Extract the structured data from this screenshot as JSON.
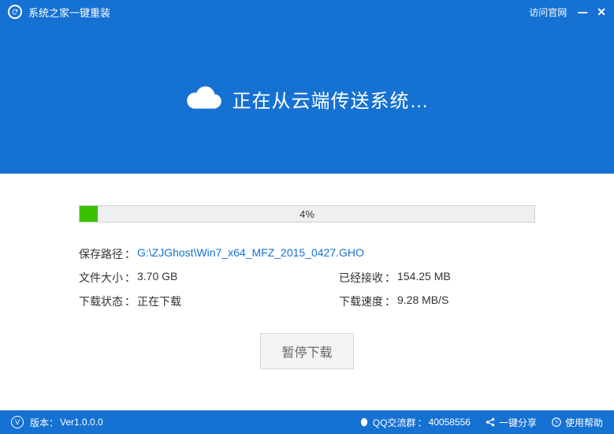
{
  "titlebar": {
    "title": "系统之家一键重装",
    "officialLink": "访问官网"
  },
  "hero": {
    "text": "正在从云端传送系统…"
  },
  "progress": {
    "percent": 4,
    "text": "4%"
  },
  "info": {
    "pathLabel": "保存路径",
    "pathValue": "G:\\ZJGhost\\Win7_x64_MFZ_2015_0427.GHO",
    "sizeLabel": "文件大小",
    "sizeValue": "3.70 GB",
    "receivedLabel": "已经接收",
    "receivedValue": "154.25 MB",
    "statusLabel": "下载状态",
    "statusValue": "正在下载",
    "speedLabel": "下载速度",
    "speedValue": "9.28 MB/S"
  },
  "buttons": {
    "pause": "暂停下载"
  },
  "footer": {
    "versionLabel": "版本：",
    "versionValue": "Ver1.0.0.0",
    "qqLabel": "QQ交流群",
    "qqValue": "40058556",
    "shareLabel": "一键分享",
    "helpLabel": "使用帮助"
  }
}
